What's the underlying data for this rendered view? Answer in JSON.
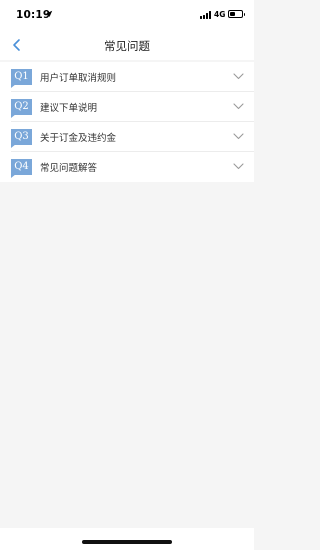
{
  "status_bar": {
    "time": "10:19",
    "network": "4G",
    "battery_level": 0.45,
    "icons": [
      "location-arrow-icon",
      "signal-icon",
      "battery-icon"
    ]
  },
  "nav": {
    "title": "常见问题",
    "back_icon": "chevron-left-icon"
  },
  "colors": {
    "accent": "#4a90d9",
    "badge": "#7aa7d9",
    "background": "#f5f5f5"
  },
  "faq": [
    {
      "badge": "Q1",
      "label": "用户订单取消规则"
    },
    {
      "badge": "Q2",
      "label": "建议下单说明"
    },
    {
      "badge": "Q3",
      "label": "关于订金及违约金"
    },
    {
      "badge": "Q4",
      "label": "常见问题解答"
    }
  ]
}
